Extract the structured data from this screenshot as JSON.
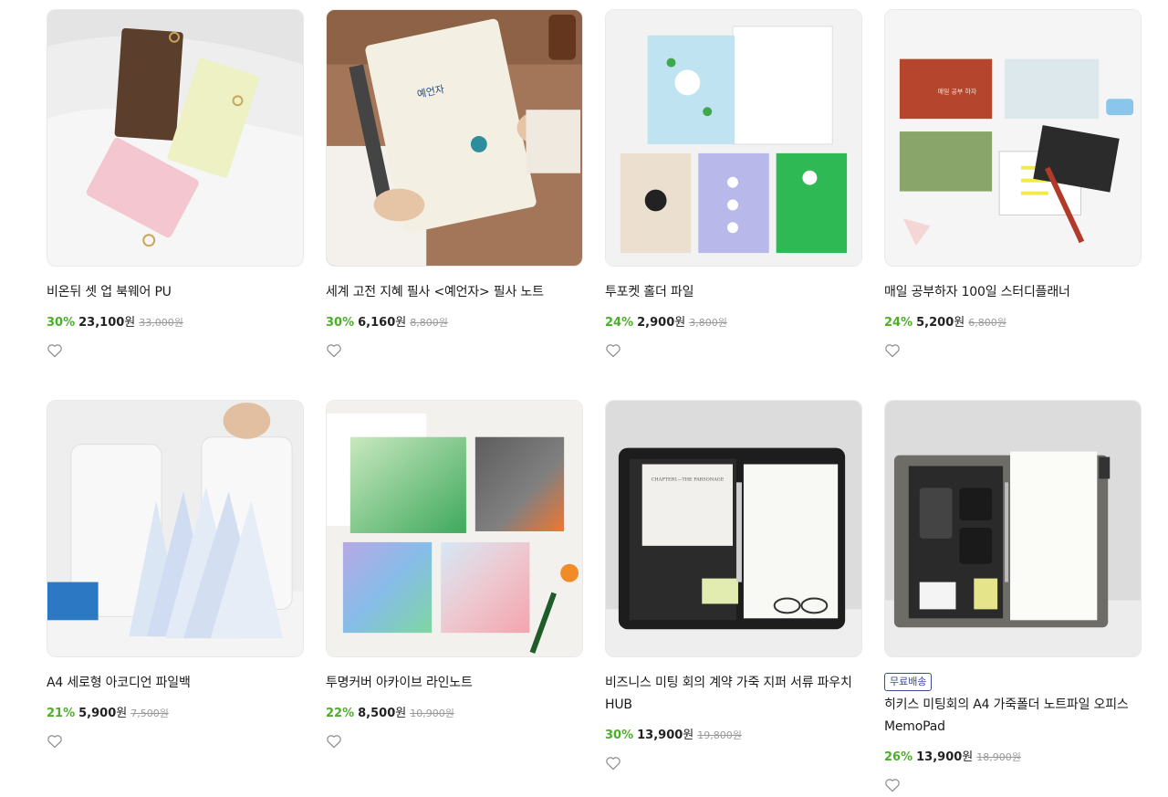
{
  "products": [
    {
      "title": "비온뒤 셋 업 북웨어 PU",
      "discount": "30%",
      "price": "23,100",
      "won": "원",
      "original": "33,000원",
      "badge": ""
    },
    {
      "title": "세계 고전 지혜 필사 <예언자> 필사 노트",
      "discount": "30%",
      "price": "6,160",
      "won": "원",
      "original": "8,800원",
      "badge": ""
    },
    {
      "title": "투포켓 홀더 파일",
      "discount": "24%",
      "price": "2,900",
      "won": "원",
      "original": "3,800원",
      "badge": ""
    },
    {
      "title": "매일 공부하자 100일 스터디플래너",
      "discount": "24%",
      "price": "5,200",
      "won": "원",
      "original": "6,800원",
      "badge": ""
    },
    {
      "title": "A4 세로형 아코디언 파일백",
      "discount": "21%",
      "price": "5,900",
      "won": "원",
      "original": "7,500원",
      "badge": ""
    },
    {
      "title": "투명커버 아카이브 라인노트",
      "discount": "22%",
      "price": "8,500",
      "won": "원",
      "original": "10,900원",
      "badge": ""
    },
    {
      "title": "비즈니스 미팅 회의 계약 가죽 지퍼 서류 파우치 HUB",
      "discount": "30%",
      "price": "13,900",
      "won": "원",
      "original": "19,800원",
      "badge": ""
    },
    {
      "title": "히키스 미팅회의 A4 가죽폴더 노트파일 오피스 MemoPad",
      "discount": "26%",
      "price": "13,900",
      "won": "원",
      "original": "18,900원",
      "badge": "무료배송"
    }
  ],
  "thumb_texts": {
    "prophet_cover": "예언자",
    "planner_cover": "매일 공부 하자",
    "chapter_text": "CHAPTER1—THE PARSONAGE"
  },
  "colors": {
    "discount": "#4caf2a",
    "badge": "#3b4a9e"
  },
  "icons": {
    "wishlist": "heart-outline-icon"
  }
}
